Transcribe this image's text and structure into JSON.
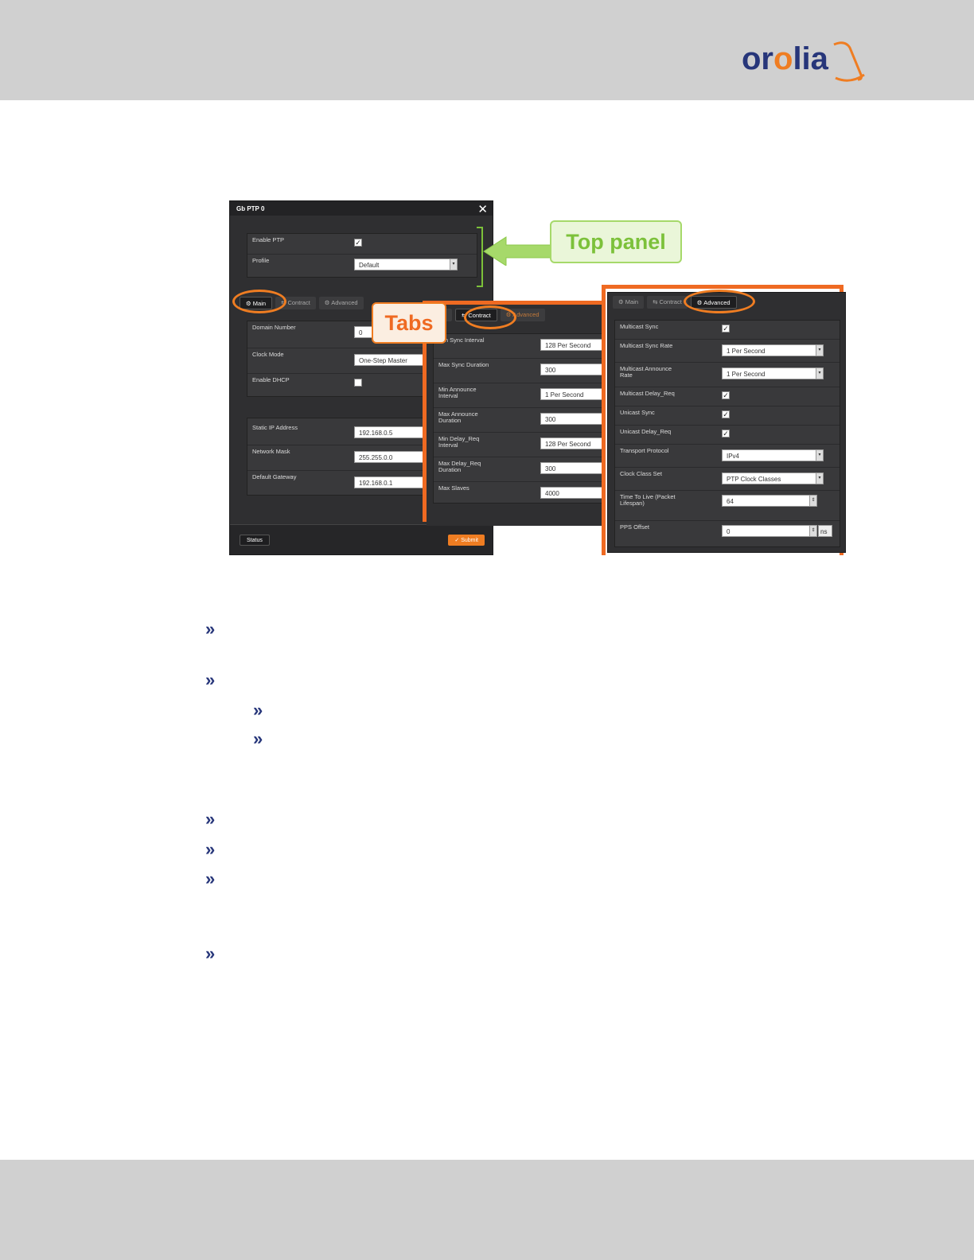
{
  "header": {
    "logo_text_a": "or",
    "logo_text_o": "o",
    "logo_text_b": "lia"
  },
  "callouts": {
    "top_panel": "Top panel",
    "tabs": "Tabs"
  },
  "main_dialog": {
    "title": "Gb PTP 0",
    "close_icon": "✕",
    "top": {
      "enable_ptp_label": "Enable PTP",
      "enable_ptp_checked": "✓",
      "profile_label": "Profile",
      "profile_value": "Default"
    },
    "tabs": [
      "⚙ Main",
      "⇆ Contract",
      "⚙ Advanced"
    ],
    "rows": {
      "domain_label": "Domain Number",
      "domain_value": "0",
      "clock_mode_label": "Clock Mode",
      "clock_mode_value": "One-Step Master",
      "dhcp_label": "Enable DHCP",
      "ip_label": "Static IP Address",
      "ip_value": "192.168.0.5",
      "mask_label": "Network Mask",
      "mask_value": "255.255.0.0",
      "gw_label": "Default Gateway",
      "gw_value": "192.168.0.1"
    },
    "status_button": "Status",
    "submit_button": "✓ Submit"
  },
  "contract_dialog": {
    "tabs": [
      "ain",
      "⇆ Contract",
      "⚙ Advanced"
    ],
    "rows": [
      {
        "label": "Min Sync Interval",
        "value": "128 Per Second"
      },
      {
        "label": "Max Sync Duration",
        "value": "300"
      },
      {
        "label": "Min Announce Interval",
        "value": "1 Per Second"
      },
      {
        "label": "Max Announce Duration",
        "value": "300"
      },
      {
        "label": "Min Delay_Req Interval",
        "value": "128 Per Second"
      },
      {
        "label": "Max Delay_Req Duration",
        "value": "300"
      },
      {
        "label": "Max Slaves",
        "value": "4000"
      }
    ]
  },
  "advanced_dialog": {
    "tabs": [
      "⚙ Main",
      "⇆ Contract",
      "⚙ Advanced"
    ],
    "rows": [
      {
        "label": "Multicast Sync",
        "check": "✓"
      },
      {
        "label": "Multicast Sync Rate",
        "value": "1 Per Second"
      },
      {
        "label": "Multicast Announce Rate",
        "value": "1 Per Second"
      },
      {
        "label": "Multicast Delay_Req",
        "check": "✓"
      },
      {
        "label": "Unicast Sync",
        "check": "✓"
      },
      {
        "label": "Unicast Delay_Req",
        "check": "✓"
      },
      {
        "label": "Transport Protocol",
        "value": "IPv4"
      },
      {
        "label": "Clock Class Set",
        "value": "PTP Clock Classes"
      },
      {
        "label": "Time To Live (Packet Lifespan)",
        "value": "64"
      },
      {
        "label": "PPS Offset",
        "value": "0",
        "unit": "ns"
      }
    ]
  },
  "bullets": [
    "»",
    "»",
    "»",
    "»",
    "»",
    "»",
    "»",
    "»"
  ],
  "colors": {
    "brand_blue": "#27367a",
    "brand_orange": "#ef7d22",
    "callout_green": "#7cc13a"
  }
}
